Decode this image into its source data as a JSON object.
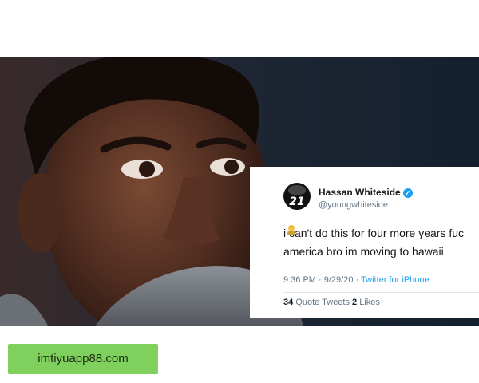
{
  "tweet": {
    "avatar_text": "21",
    "name": "Hassan Whiteside",
    "handle": "@youngwhiteside",
    "text_line1": "i can't do this for four more years fuc",
    "text_line2": "america bro im moving to hawaii",
    "emoji_icon": "person-emoji-icon",
    "timestamp": "9:36 PM · 9/29/20 ·",
    "source": "Twitter for iPhone",
    "quote_count": "34",
    "quote_label": "Quote Tweets",
    "like_count": "2",
    "like_label": "Likes",
    "verified_color": "#1da1f2"
  },
  "watermark": {
    "text": "imtiyuapp88.com",
    "color": "#7fd05d"
  }
}
